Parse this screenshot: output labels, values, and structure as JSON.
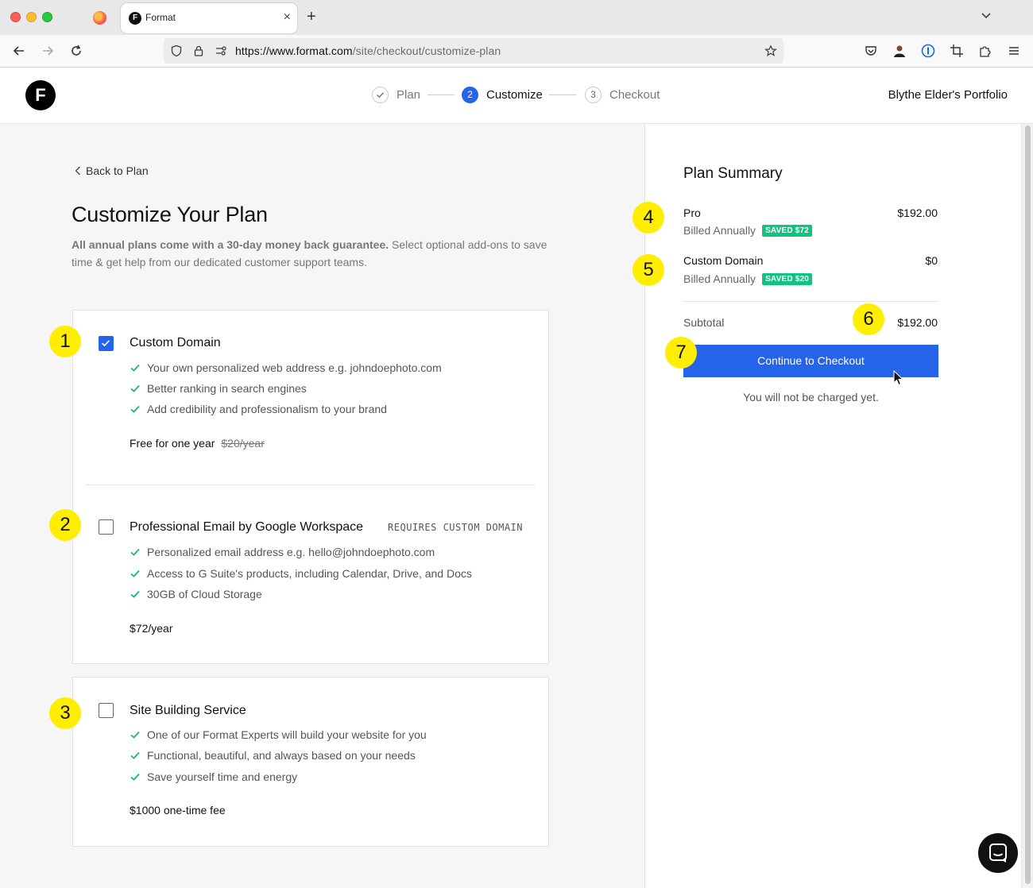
{
  "browser": {
    "tab_title": "Format",
    "tab_favicon_letter": "F",
    "url_host": "https://www.format.com",
    "url_path": "/site/checkout/customize-plan",
    "new_tab": "+",
    "close_tab": "×"
  },
  "header": {
    "logo_letter": "F",
    "steps": [
      {
        "number": "",
        "label": "Plan",
        "state": "done"
      },
      {
        "number": "2",
        "label": "Customize",
        "state": "active"
      },
      {
        "number": "3",
        "label": "Checkout",
        "state": "upcoming"
      }
    ],
    "portfolio": "Blythe Elder's Portfolio"
  },
  "main": {
    "back_label": "Back to Plan",
    "title": "Customize Your Plan",
    "subtitle_bold": "All annual plans come with a 30-day money back guarantee.",
    "subtitle_rest": " Select optional add-ons to save time & get help from our dedicated customer support teams.",
    "addons": [
      {
        "title": "Custom Domain",
        "checked": true,
        "tag": "",
        "features": [
          "Your own personalized web address e.g. johndoephoto.com",
          "Better ranking in search engines",
          "Add credibility and professionalism to your brand"
        ],
        "price": "Free for one year",
        "price_strike": "$20/year"
      },
      {
        "title": "Professional Email by Google Workspace",
        "checked": false,
        "tag": "REQUIRES CUSTOM DOMAIN",
        "features": [
          "Personalized email address e.g. hello@johndoephoto.com",
          "Access to G Suite's products, including Calendar, Drive, and Docs",
          "30GB of Cloud Storage"
        ],
        "price": "$72/year",
        "price_strike": ""
      },
      {
        "title": "Site Building Service",
        "checked": false,
        "tag": "",
        "features": [
          "One of our Format Experts will build your website for you",
          "Functional, beautiful, and always based on your needs",
          "Save yourself time and energy"
        ],
        "price": "$1000 one-time fee",
        "price_strike": ""
      }
    ]
  },
  "summary": {
    "title": "Plan Summary",
    "items": [
      {
        "name": "Pro",
        "billing": "Billed Annually",
        "saved": "SAVED $72",
        "price": "$192.00"
      },
      {
        "name": "Custom Domain",
        "billing": "Billed Annually",
        "saved": "SAVED $20",
        "price": "$0"
      }
    ],
    "subtotal_label": "Subtotal",
    "subtotal_value": "$192.00",
    "cta": "Continue to Checkout",
    "note": "You will not be charged yet."
  },
  "annotations": [
    "1",
    "2",
    "3",
    "4",
    "5",
    "6",
    "7"
  ],
  "colors": {
    "accent": "#2563eb",
    "saved_badge": "#11c47e",
    "annotation_badge": "#ffee00",
    "check_green": "#11b886"
  }
}
